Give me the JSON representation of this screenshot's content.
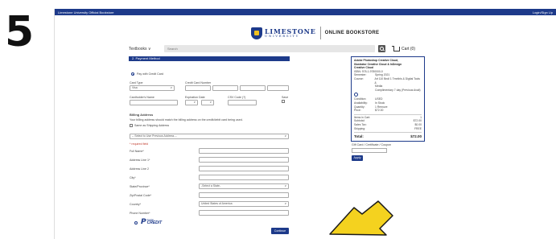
{
  "step_number": "5",
  "top_bar": {
    "left": "Limestone University Official Bookstore",
    "right": "Login/Sign Up"
  },
  "logo": {
    "name": "LIMESTONE",
    "sub": "UNIVERSITY",
    "store": "ONLINE BOOKSTORE"
  },
  "nav": {
    "textbooks": "Textbooks ∨",
    "search_placeholder": "Search",
    "cart": "Cart (0)"
  },
  "payment": {
    "header": "2. Payment Method",
    "pay_credit": "Pay with Credit Card",
    "card_type_label": "Card Type",
    "card_type_value": "Visa",
    "card_number_label": "Credit Card Number",
    "cardholder_label": "Cardholder's Name",
    "expiration_label": "Expiration Date",
    "csv_label": "CSV Code (?)",
    "save_label": "Save"
  },
  "billing": {
    "title": "Billing Address",
    "note": "Your billing address should match the billing address on the credit/debit card being used.",
    "same_as_shipping": "Same as Shipping Address",
    "previous_address": "-- Select to Use Previous Address --",
    "required_note": "* required field",
    "full_name": "Full Name*",
    "address1": "Address Line 1*",
    "address2": "Address Line 2",
    "city": "City*",
    "state": "State/Province*",
    "state_value": "-Select a State-",
    "zip": "Zip/Postal Code*",
    "country": "Country*",
    "country_value": "United States of America",
    "phone": "Phone Number*"
  },
  "paypal": {
    "small": "PayPal",
    "credit": "CREDIT"
  },
  "order": {
    "lines": [
      "Adobe Photoshop Creative Cloud,",
      "Illustrator Creative Cloud & InDesign",
      "Creative Cloud",
      "ISBN: 978-1-9780000-0"
    ],
    "details": [
      {
        "k": "Semester:",
        "v": "Spring 2021"
      },
      {
        "k": "Course:",
        "v": "Art 110 Bndl 1 Tmnthls & Digital Tools &"
      },
      {
        "k": "",
        "v": "Media"
      },
      {
        "k": "",
        "v": "Complimentary 7 day (Previous Avail)"
      }
    ],
    "condition": [
      {
        "k": "Condition:",
        "v": "USED"
      },
      {
        "k": "Availability:",
        "v": "In Stock"
      },
      {
        "k": "Quantity:",
        "v": "1 Remove"
      },
      {
        "k": "Price:",
        "v": "$72.00"
      }
    ],
    "totals": [
      {
        "k": "Items in Cart:",
        "v": "1"
      },
      {
        "k": "Subtotal:",
        "v": "$72.00"
      },
      {
        "k": "Sales Tax:",
        "v": "$0.00"
      },
      {
        "k": "Shipping:",
        "v": "FREE"
      }
    ],
    "total_label": "Total:",
    "total_value": "$72.00"
  },
  "gift": {
    "label": "Gift Card / Certificate / Coupon",
    "apply": "Apply"
  },
  "continue": "Continue",
  "colors": {
    "brand": "#1d3a8a",
    "arrow": "#f4d21f"
  }
}
